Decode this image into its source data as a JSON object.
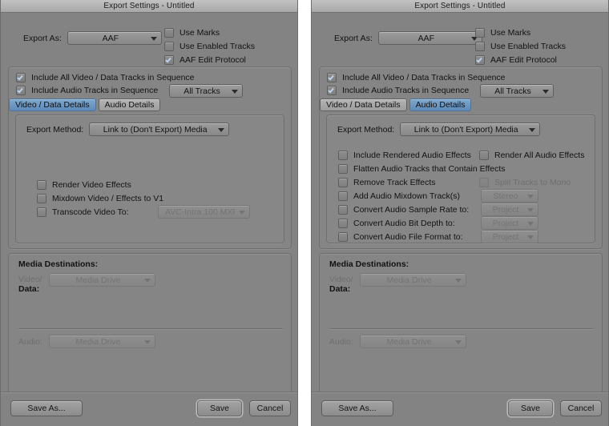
{
  "window_title": "Export Settings - Untitled",
  "colors": {
    "window_bg": "#838383",
    "titlebar": "#b5b5b5",
    "tab_active": "#5d8ab7",
    "checkmark": "#b9d3ee",
    "border": "#6f6f6f",
    "text": "#121212",
    "text_disabled": "#737373"
  },
  "header": {
    "export_as_label": "Export As:",
    "export_as_value": "AAF",
    "options": [
      {
        "label": "Use Marks",
        "checked": false
      },
      {
        "label": "Use Enabled Tracks",
        "checked": false
      },
      {
        "label": "AAF Edit Protocol",
        "checked": true
      }
    ]
  },
  "tracks": {
    "include_video_label": "Include All Video / Data Tracks in Sequence",
    "include_video_checked": true,
    "include_audio_label": "Include Audio Tracks in Sequence",
    "include_audio_checked": true,
    "tracks_popup_value": "All Tracks",
    "tabs": [
      {
        "label": "Video / Data Details"
      },
      {
        "label": "Audio Details"
      }
    ]
  },
  "left_panel": {
    "active_tab_index": 0,
    "export_method_label": "Export Method:",
    "export_method_value": "Link to (Don't Export) Media",
    "checkboxes": [
      {
        "label": "Render Video Effects",
        "checked": false,
        "disabled": false
      },
      {
        "label": "Mixdown Video / Effects to V1",
        "checked": false,
        "disabled": false
      },
      {
        "label": "Transcode Video To:",
        "checked": false,
        "disabled": false
      }
    ],
    "transcode_popup_value": "AVC-Intra 100 MXF",
    "transcode_popup_disabled": true
  },
  "right_panel": {
    "active_tab_index": 1,
    "export_method_label": "Export Method:",
    "export_method_value": "Link to (Don't Export) Media",
    "left_column": [
      {
        "label": "Include Rendered Audio Effects",
        "checked": false,
        "disabled": false
      },
      {
        "label": "Flatten Audio Tracks that Contain Effects",
        "checked": false,
        "disabled": false
      },
      {
        "label": "Remove Track Effects",
        "checked": false,
        "disabled": false
      },
      {
        "label": "Add Audio Mixdown Track(s)",
        "checked": false,
        "disabled": false
      },
      {
        "label": "Convert Audio Sample Rate to:",
        "checked": false,
        "disabled": false
      },
      {
        "label": "Convert Audio Bit Depth to:",
        "checked": false,
        "disabled": false
      },
      {
        "label": "Convert Audio File Format to:",
        "checked": false,
        "disabled": false
      }
    ],
    "right_column": [
      {
        "label": "Render All Audio Effects",
        "checked": false,
        "disabled": false
      },
      {
        "label": "Split Tracks to Mono",
        "checked": false,
        "disabled": true
      }
    ],
    "right_popups": [
      {
        "value": "Stereo",
        "disabled": true
      },
      {
        "value": "Project",
        "disabled": true
      },
      {
        "value": "Project",
        "disabled": true
      },
      {
        "value": "Project",
        "disabled": true
      }
    ]
  },
  "media_destinations": {
    "title": "Media Destinations:",
    "video_label_line1": "Video/",
    "video_label_line2": "Data:",
    "video_value": "Media Drive",
    "audio_label": "Audio:",
    "audio_value": "Media Drive"
  },
  "footer": {
    "save_as_label": "Save As...",
    "save_label": "Save",
    "cancel_label": "Cancel"
  }
}
